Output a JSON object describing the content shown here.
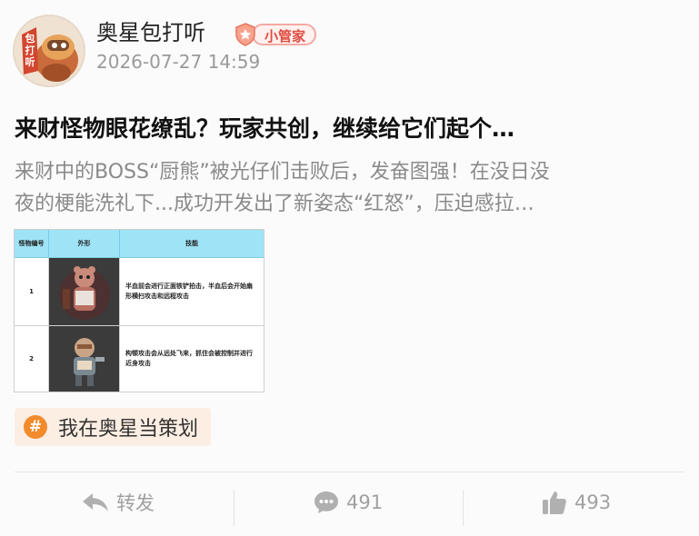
{
  "author": {
    "name": "奥星包打听",
    "badge": "小管家",
    "avatar_text": "包打听"
  },
  "post": {
    "time": "2026-07-27 14:59",
    "title": "来财怪物眼花缭乱？玩家共创，继续给它们起个…",
    "summary_line1": "来财中的BOSS“厨熊”被光仔们击败后，发奋图强！在没日没",
    "summary_line2": "夜的梗能洗礼下...成功开发出了新姿态“红怒”，压迫感拉…"
  },
  "image_table": {
    "headers": [
      "怪物编号",
      "外形",
      "技能"
    ],
    "rows": [
      {
        "id": "1",
        "skill": "半血前会进行正面铁铲拍击，半血后会开始扇形横扫攻击和远程攻击"
      },
      {
        "id": "2",
        "skill": "构顿攻击会从远处飞来，抓住会被控制并进行近身攻击"
      }
    ]
  },
  "topic": {
    "label": "我在奥星当策划"
  },
  "actions": {
    "share": "转发",
    "comments": "491",
    "likes": "493"
  },
  "colors": {
    "accent_orange": "#f28b2c",
    "badge_red": "#e04a3f",
    "table_header": "#9fe3f7"
  }
}
